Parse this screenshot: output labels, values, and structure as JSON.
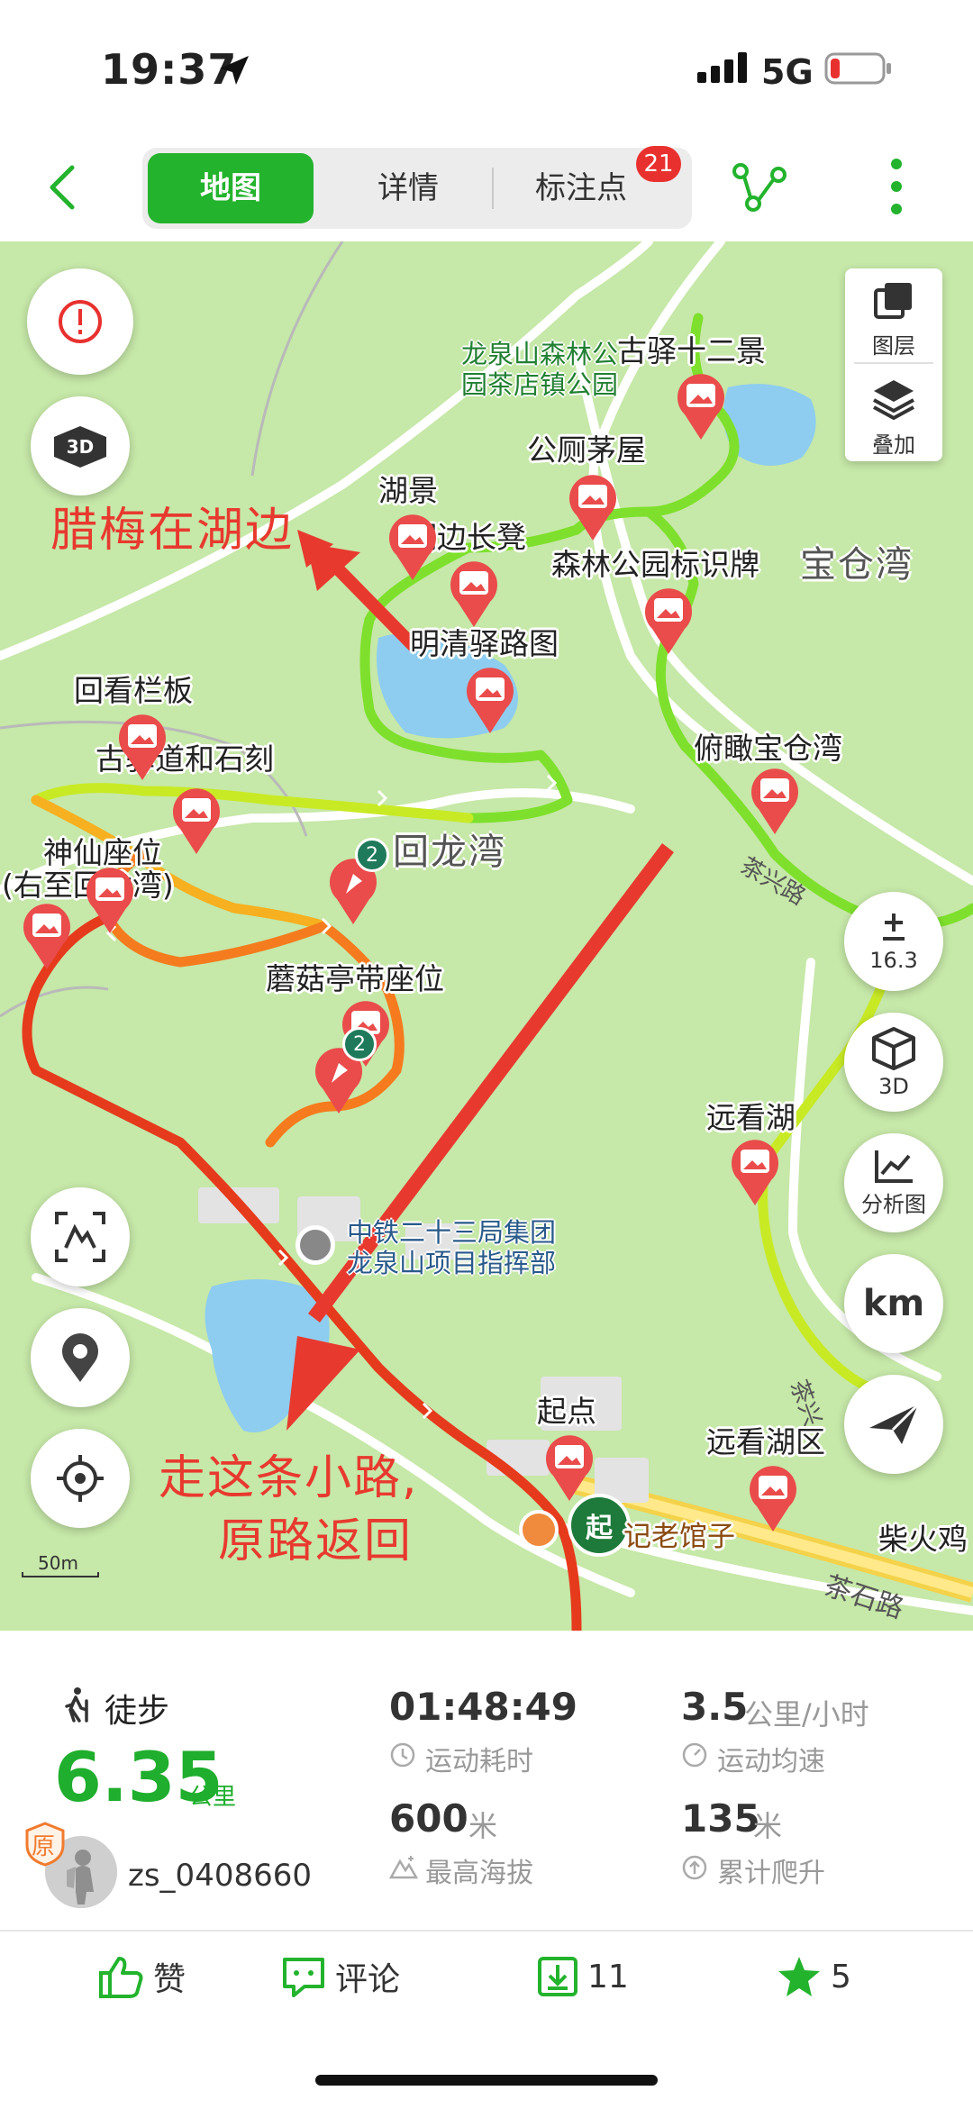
{
  "status_bar": {
    "time": "19:37",
    "network": "5G"
  },
  "header": {
    "tabs": [
      {
        "label": "地图",
        "active": true
      },
      {
        "label": "详情",
        "active": false
      },
      {
        "label": "标注点",
        "active": false,
        "badge": "21"
      }
    ]
  },
  "map": {
    "layer_panel": {
      "layers": "图层",
      "overlay": "叠加"
    },
    "zoom": {
      "label": "16.3"
    },
    "buttons": {
      "three_d": "3D",
      "analysis": "分析图",
      "km": "km"
    },
    "scale": "50m",
    "start_label": "起",
    "waypoints": [
      "古驿十二景",
      "公厕茅屋",
      "湖景",
      "湖边长凳",
      "森林公园标识牌",
      "明清驿路图",
      "回看栏板",
      "古驿道和石刻",
      "俯瞰宝仓湾",
      "神仙座位",
      "(右至回龙湾)",
      "蘑菇亭带座位",
      "远看湖",
      "起点",
      "远看湖区",
      "柴火鸡"
    ],
    "areas": [
      "宝仓湾",
      "回龙湾"
    ],
    "park_label": [
      "龙泉山森林公",
      "园茶店镇公园"
    ],
    "poi_label": [
      "中铁二十三局集团",
      "龙泉山项目指挥部"
    ],
    "restaurant": "记老馆子",
    "roads": [
      "茶兴路",
      "茶石路",
      "茶兴"
    ],
    "pin_counts": [
      "2",
      "2"
    ],
    "annotations": {
      "top": "腊梅在湖边",
      "bottom_line1": "走这条小路,",
      "bottom_line2": "原路返回"
    }
  },
  "stats": {
    "sport_type": "徒步",
    "distance": "6.35",
    "distance_unit": "公里",
    "duration": "01:48:49",
    "duration_label": "运动耗时",
    "speed": "3.5",
    "speed_unit": "公里/小时",
    "speed_label": "运动均速",
    "max_alt": "600",
    "max_alt_unit": "米",
    "max_alt_label": "最高海拔",
    "climb": "135",
    "climb_unit": "米",
    "climb_label": "累计爬升",
    "user": "zs_0408660",
    "badge": "原"
  },
  "actions": {
    "like": "赞",
    "comment": "评论",
    "download": "11",
    "favorite": "5"
  },
  "colors": {
    "accent": "#23b32d",
    "badge": "#e8312f",
    "annotation": "#e8392f"
  }
}
